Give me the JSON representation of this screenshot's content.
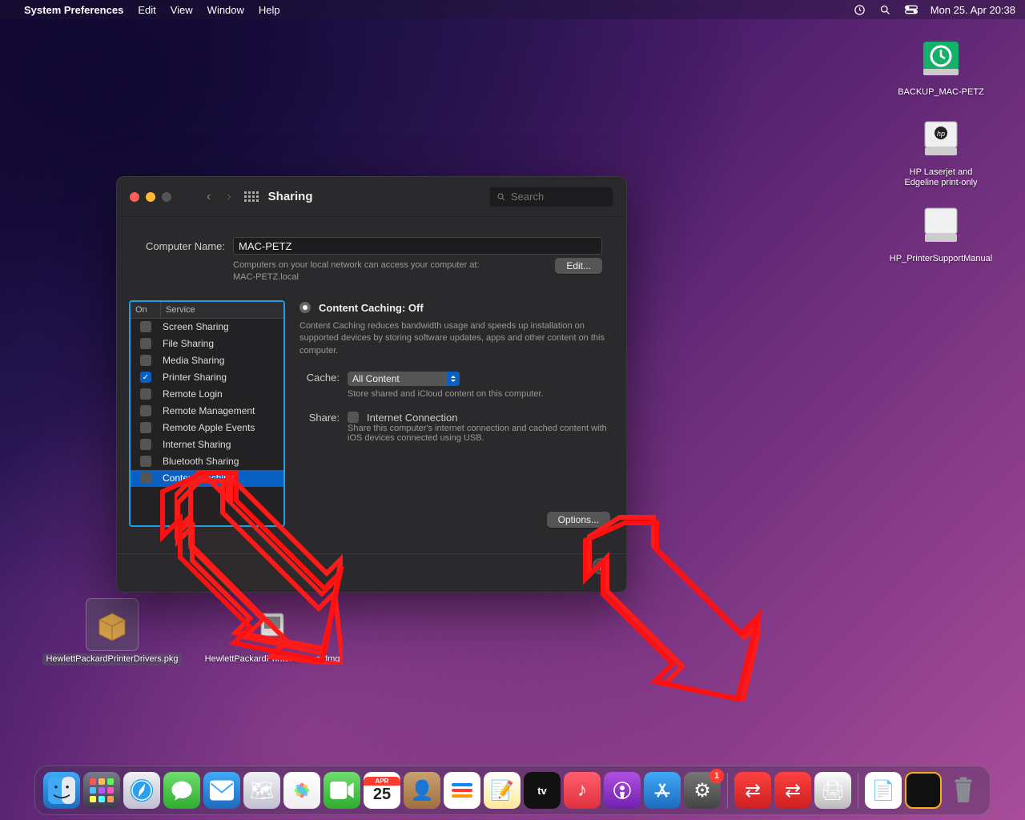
{
  "menubar": {
    "app": "System Preferences",
    "items": [
      "Edit",
      "View",
      "Window",
      "Help"
    ],
    "clock": "Mon 25. Apr  20:38"
  },
  "desktop": {
    "backup": "BACKUP_MAC-PETZ",
    "hp1": "HP Laserjet and Edgeline print-only",
    "hp2": "HP_PrinterSupportManual",
    "pkg": "HewlettPackardPrinterDrivers.pkg",
    "dmg": "HewlettPackardPrinterDrivers.dmg"
  },
  "dock": {
    "cal_month": "APR",
    "cal_day": "25",
    "badge": "1"
  },
  "prefs": {
    "title": "Sharing",
    "search_placeholder": "Search",
    "computer_name_label": "Computer Name:",
    "computer_name": "MAC-PETZ",
    "hint": "Computers on your local network can access your computer at:\nMAC-PETZ.local",
    "edit_btn": "Edit...",
    "col_on": "On",
    "col_service": "Service",
    "services": [
      {
        "name": "Screen Sharing",
        "on": false,
        "sel": false
      },
      {
        "name": "File Sharing",
        "on": false,
        "sel": false
      },
      {
        "name": "Media Sharing",
        "on": false,
        "sel": false
      },
      {
        "name": "Printer Sharing",
        "on": true,
        "sel": false
      },
      {
        "name": "Remote Login",
        "on": false,
        "sel": false
      },
      {
        "name": "Remote Management",
        "on": false,
        "sel": false
      },
      {
        "name": "Remote Apple Events",
        "on": false,
        "sel": false
      },
      {
        "name": "Internet Sharing",
        "on": false,
        "sel": false
      },
      {
        "name": "Bluetooth Sharing",
        "on": false,
        "sel": false
      },
      {
        "name": "Content Caching",
        "on": false,
        "sel": true
      }
    ],
    "detail": {
      "header": "Content Caching: Off",
      "desc": "Content Caching reduces bandwidth usage and speeds up installation on supported devices by storing software updates, apps and other content on this computer.",
      "cache_label": "Cache:",
      "cache_value": "All Content",
      "cache_hint": "Store shared and iCloud content on this computer.",
      "share_label": "Share:",
      "share_text": "Internet Connection",
      "share_hint": "Share this computer's internet connection and cached content with iOS devices connected using USB.",
      "options_btn": "Options..."
    },
    "help": "?"
  }
}
